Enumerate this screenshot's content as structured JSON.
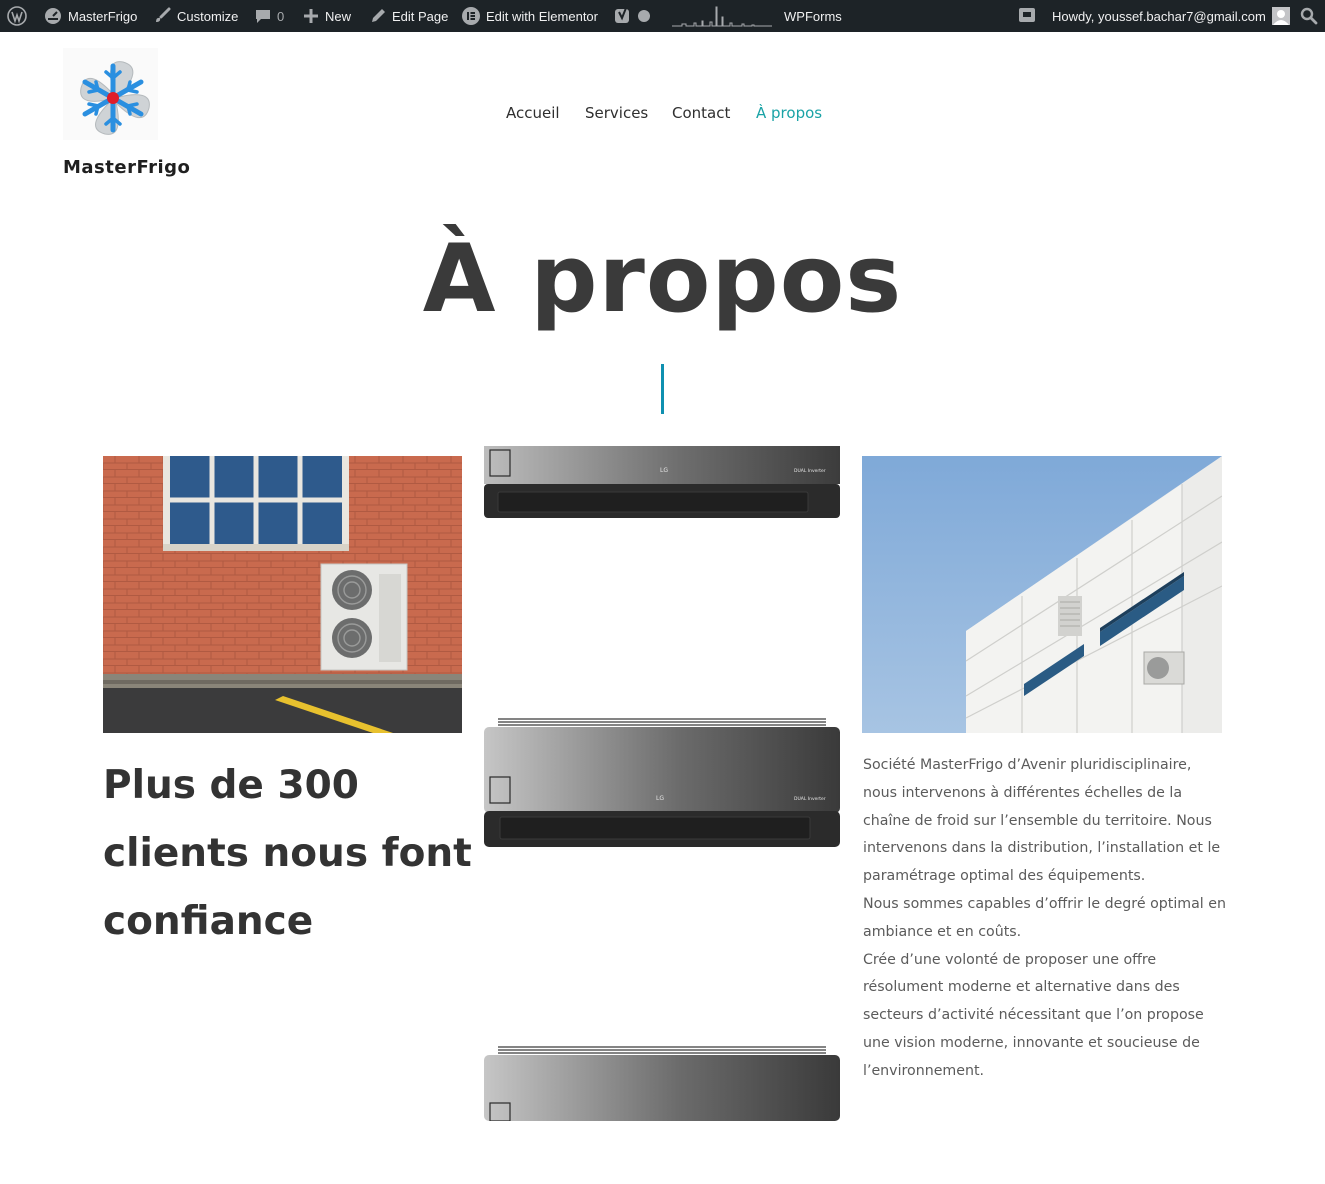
{
  "admin_bar": {
    "site_name": "MasterFrigo",
    "customize": "Customize",
    "comments_count": "0",
    "new": "New",
    "edit_page": "Edit Page",
    "edit_elementor": "Edit with Elementor",
    "wpforms": "WPForms",
    "howdy": "Howdy, youssef.bachar7@gmail.com"
  },
  "header": {
    "logo_text": "MasterFrigo",
    "nav": [
      {
        "label": "Accueil",
        "active": false
      },
      {
        "label": "Services",
        "active": false
      },
      {
        "label": "Contact",
        "active": false
      },
      {
        "label": "À propos",
        "active": true
      }
    ]
  },
  "page": {
    "title": "À propos",
    "headline_lines": [
      "Plus de 300",
      "clients nous font",
      "confiance"
    ],
    "about_paragraphs": [
      "Société MasterFrigo d’Avenir pluridisciplinaire, nous intervenons à différentes échelles de la chaîne de froid sur l’ensemble du territoire. Nous intervenons dans la distribution, l’installation et le paramétrage optimal des équipements.",
      "Nous sommes capables d’offrir le degré optimal en ambiance et en coûts.",
      "Crée d’une volonté de proposer une offre résolument moderne et alternative dans des secteurs d’activité nécessitant que l’on propose une vision moderne, innovante et soucieuse de l’environnement."
    ],
    "ac_brand": "LG",
    "ac_model_label": "DUAL Inverter"
  },
  "colors": {
    "admin_bar_bg": "#1d2327",
    "accent": "#1aa3a6",
    "title_rule": "#0f90b0",
    "heading": "#333333",
    "body_text": "#5b5b5b"
  }
}
